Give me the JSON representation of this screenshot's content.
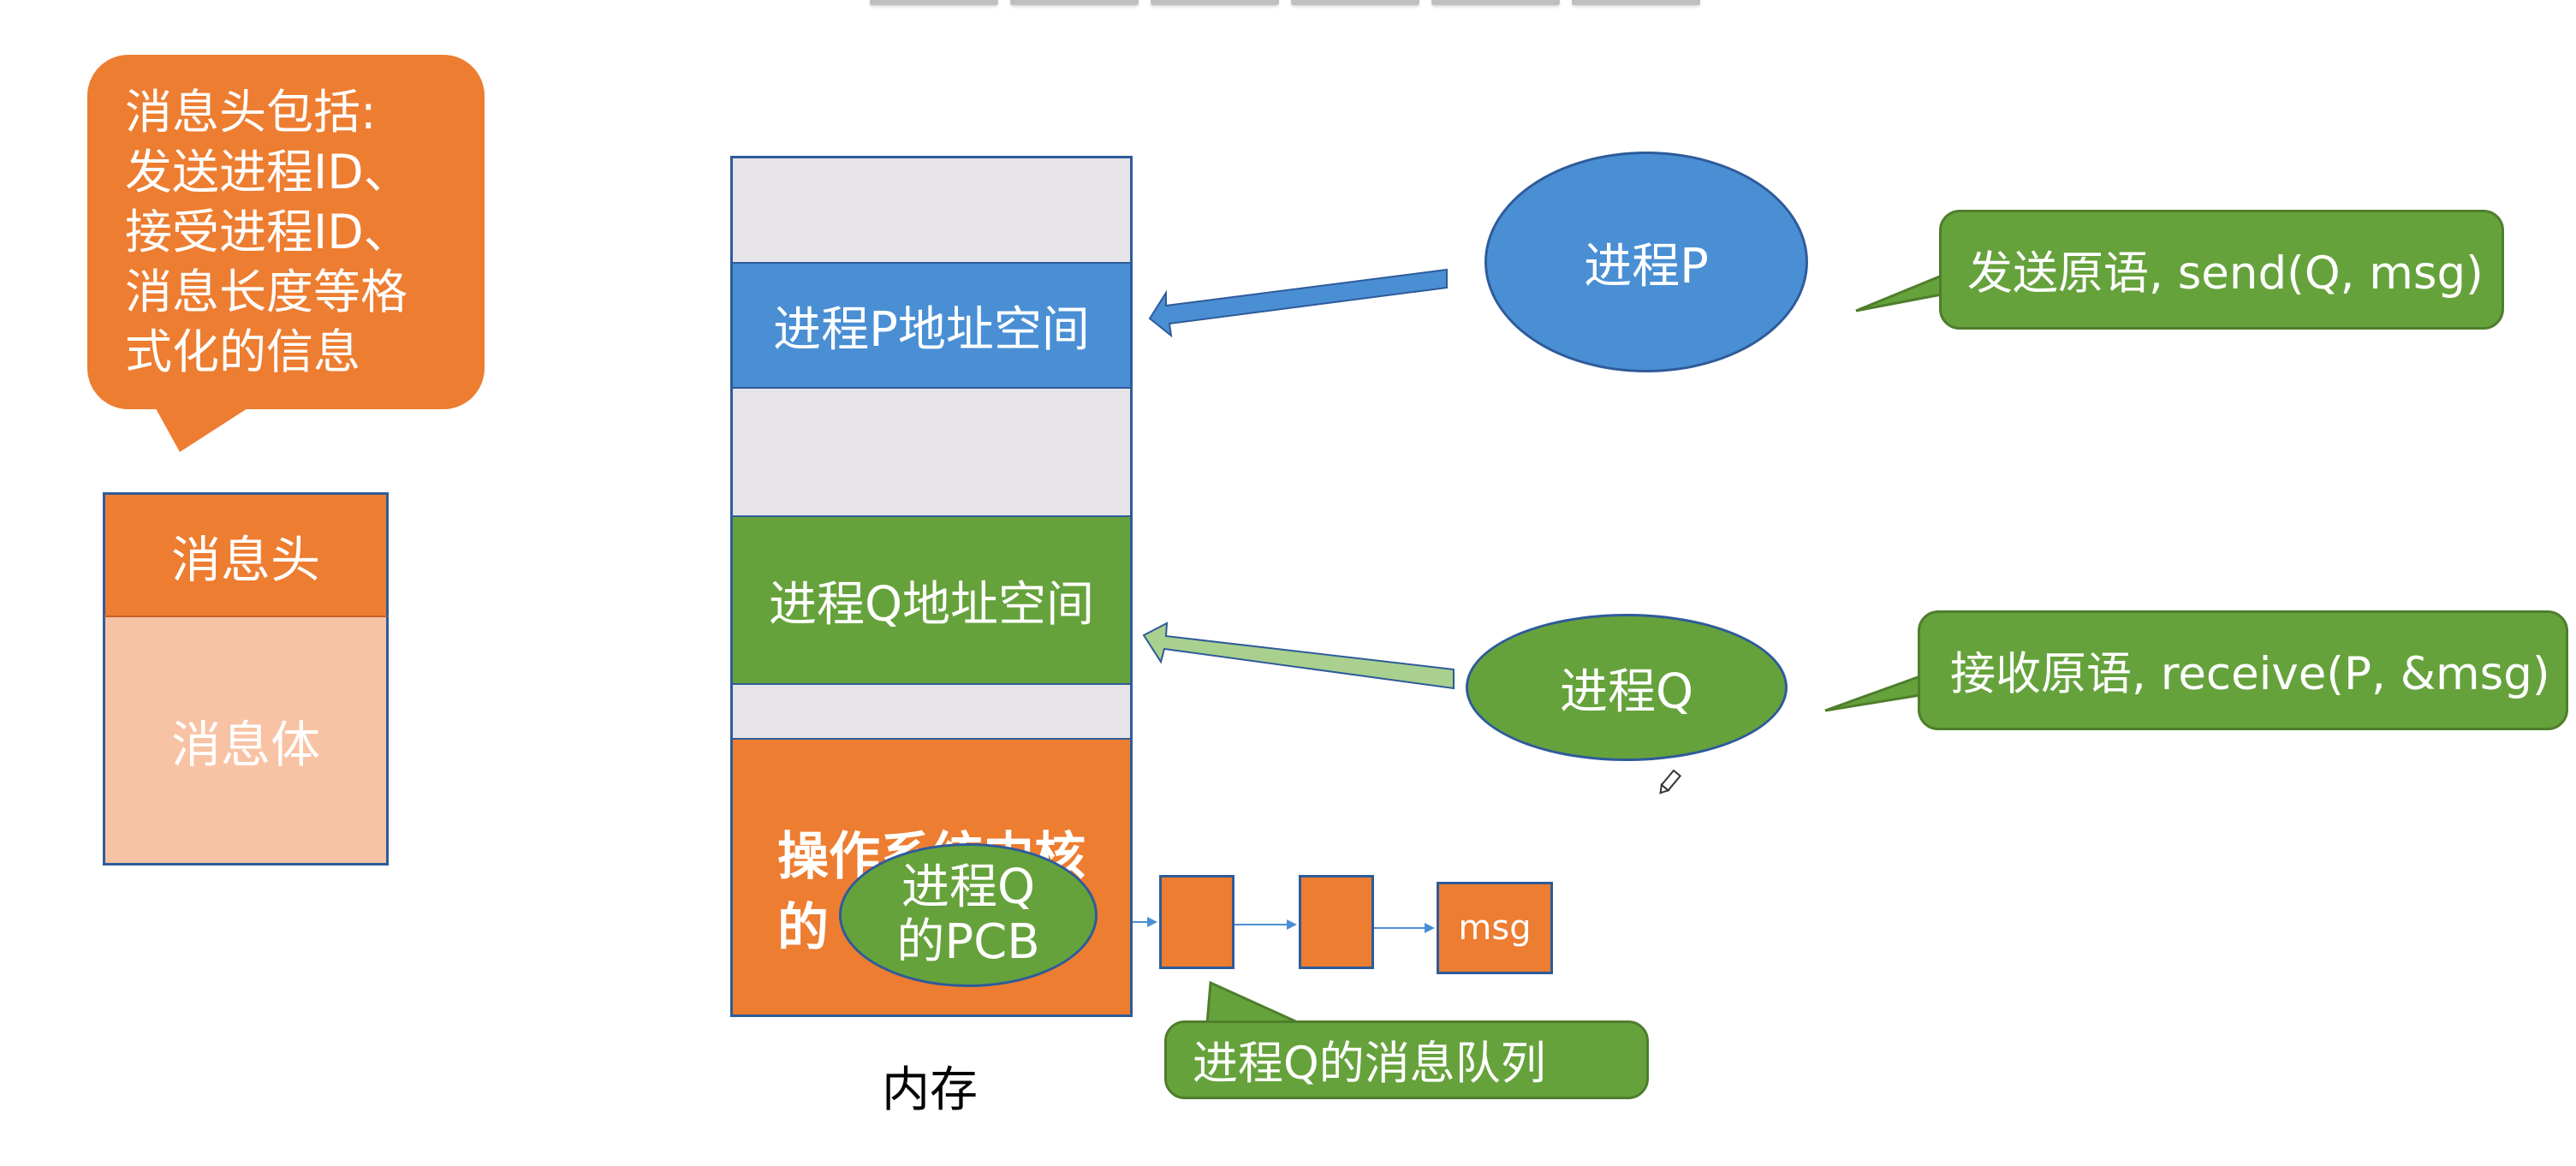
{
  "header_info": {
    "lines": [
      "消息头包括:",
      "发送进程ID、",
      "接受进程ID、",
      "消息长度等格",
      "式化的信息"
    ]
  },
  "message": {
    "head": "消息头",
    "body": "消息体"
  },
  "memory": {
    "p_space": "进程P地址空间",
    "q_space": "进程Q地址空间",
    "os_kernel_line1": "操作系统内核",
    "os_kernel_line2": "的",
    "label": "内存"
  },
  "processes": {
    "p": "进程P",
    "q": "进程Q",
    "pcb_line1": "进程Q",
    "pcb_line2": "的PCB"
  },
  "primitives": {
    "send": "发送原语, send(Q, msg)",
    "receive": "接收原语, receive(P, &msg)"
  },
  "queue": {
    "msg": "msg",
    "label": "进程Q的消息队列"
  },
  "colors": {
    "orange": "#ed7d31",
    "light_orange": "#f8c3a4",
    "blue": "#4a8fd4",
    "green": "#66a23c",
    "light_green": "#a9d08e",
    "gray": "#e6e4e6",
    "border_blue": "#2e5b9a"
  }
}
